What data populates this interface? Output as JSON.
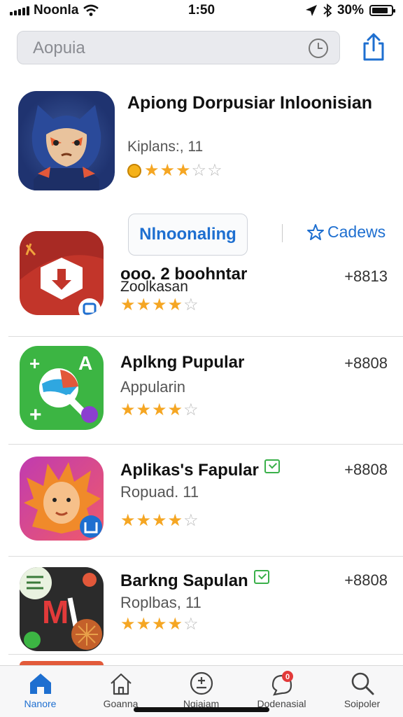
{
  "status_bar": {
    "carrier": "Noonla",
    "time": "1:50",
    "battery_text": "30%",
    "battery_level": 0.85
  },
  "search": {
    "placeholder": "Aopuia",
    "icon": "clock-icon"
  },
  "header": {
    "share_icon": "share-icon"
  },
  "featured": {
    "title": "Apiong Dorpusiar Inloonisian",
    "subtitle": "Kiplans:, 11",
    "rating": 2.5,
    "icon_colors": [
      "#1f3370",
      "#e2583a"
    ]
  },
  "segmented": {
    "primary": "Nlnoonaling",
    "secondary": "Cadews",
    "secondary_icon": "star-outline-icon"
  },
  "apps": [
    {
      "title": "ooo. 2 boohntar",
      "subtitle": "Zoolkasan",
      "price": "+8813",
      "rating": 4,
      "verified": false,
      "accent": "#c2352a"
    },
    {
      "title": "Aplkng Pupular",
      "subtitle": "Appularin",
      "price": "+8808",
      "rating": 4,
      "verified": false,
      "accent": "#3cb543"
    },
    {
      "title": "Aplikas's Fapular",
      "subtitle": "Ropuad. 11",
      "price": "+8808",
      "rating": 4,
      "verified": true,
      "accent": "#d8358e"
    },
    {
      "title": "Barkng Sapulan",
      "subtitle": "Roplbas, 11",
      "price": "+8808",
      "rating": 4,
      "verified": true,
      "accent": "#2b2b2b"
    }
  ],
  "tab_bar": {
    "items": [
      {
        "label": "Nanore",
        "icon": "home-icon",
        "active": true
      },
      {
        "label": "Goanna",
        "icon": "house-outline-icon",
        "active": false
      },
      {
        "label": "Ngiajam",
        "icon": "plus-minus-icon",
        "active": false
      },
      {
        "label": "Dodenasial",
        "icon": "notification-icon",
        "active": false,
        "badge": "0"
      },
      {
        "label": "Soipoler",
        "icon": "search-icon",
        "active": false
      }
    ]
  }
}
